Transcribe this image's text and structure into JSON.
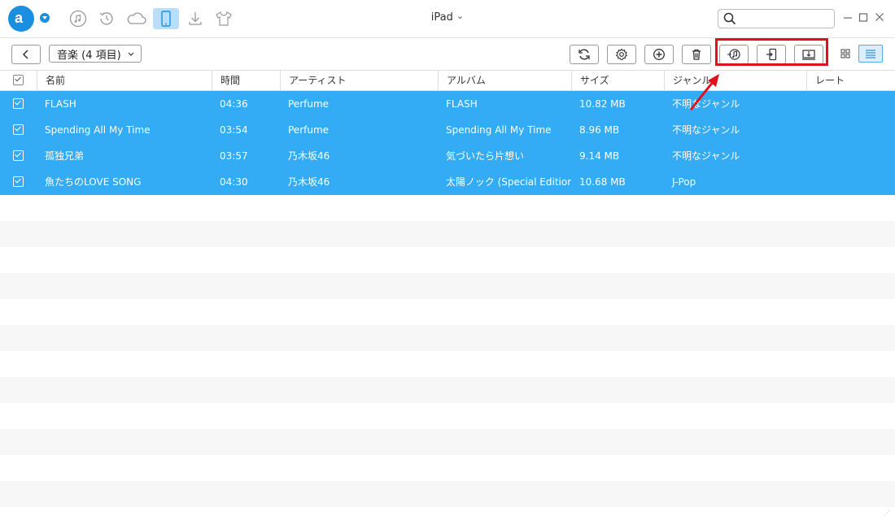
{
  "app": {
    "logo_letter": "a",
    "brand_color": "#1a8fe0"
  },
  "nav": [
    "music-note-icon",
    "history-icon",
    "cloud-icon",
    "device-icon",
    "download-icon",
    "tshirt-icon"
  ],
  "device": {
    "name": "iPad",
    "chevron": "⌄"
  },
  "search": {
    "placeholder": ""
  },
  "toolbar": {
    "category": "音楽 (4 項目)",
    "buttons": [
      "refresh-icon",
      "settings-icon",
      "add-icon",
      "delete-icon",
      "send-to-itunes-icon",
      "send-to-device-icon",
      "send-to-computer-icon"
    ],
    "highlight_color": "#e2101c"
  },
  "table": {
    "columns": [
      "名前",
      "時間",
      "アーティスト",
      "アルバム",
      "サイズ",
      "ジャンル",
      "レート"
    ],
    "rows": [
      {
        "name": "FLASH",
        "time": "04:36",
        "artist": "Perfume",
        "album": "FLASH",
        "size": "10.82 MB",
        "genre": "不明なジャンル",
        "rate": ""
      },
      {
        "name": "Spending All My Time",
        "time": "03:54",
        "artist": "Perfume",
        "album": "Spending All My Time",
        "size": "8.96 MB",
        "genre": "不明なジャンル",
        "rate": ""
      },
      {
        "name": "孤独兄弟",
        "time": "03:57",
        "artist": "乃木坂46",
        "album": "気づいたら片想い",
        "size": "9.14 MB",
        "genre": "不明なジャンル",
        "rate": ""
      },
      {
        "name": "魚たちのLOVE SONG",
        "time": "04:30",
        "artist": "乃木坂46",
        "album": "太陽ノック (Special Edition)",
        "size": "10.68 MB",
        "genre": "J-Pop",
        "rate": ""
      }
    ],
    "selection_color": "#34abf5"
  }
}
